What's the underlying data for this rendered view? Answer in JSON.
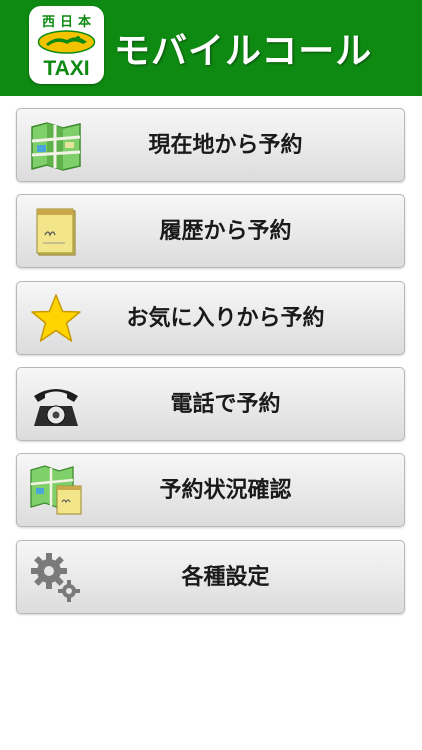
{
  "header": {
    "logo_kanji": "西日本",
    "logo_taxi": "TAXI",
    "title": "モバイルコール"
  },
  "menu": [
    {
      "label": "現在地から予約",
      "icon": "map-icon"
    },
    {
      "label": "履歴から予約",
      "icon": "notepad-icon"
    },
    {
      "label": "お気に入りから予約",
      "icon": "star-icon"
    },
    {
      "label": "電話で予約",
      "icon": "telephone-icon"
    },
    {
      "label": "予約状況確認",
      "icon": "map-notepad-icon"
    },
    {
      "label": "各種設定",
      "icon": "gears-icon"
    }
  ],
  "colors": {
    "header": "#0e8a12",
    "star": "#ffd400"
  }
}
